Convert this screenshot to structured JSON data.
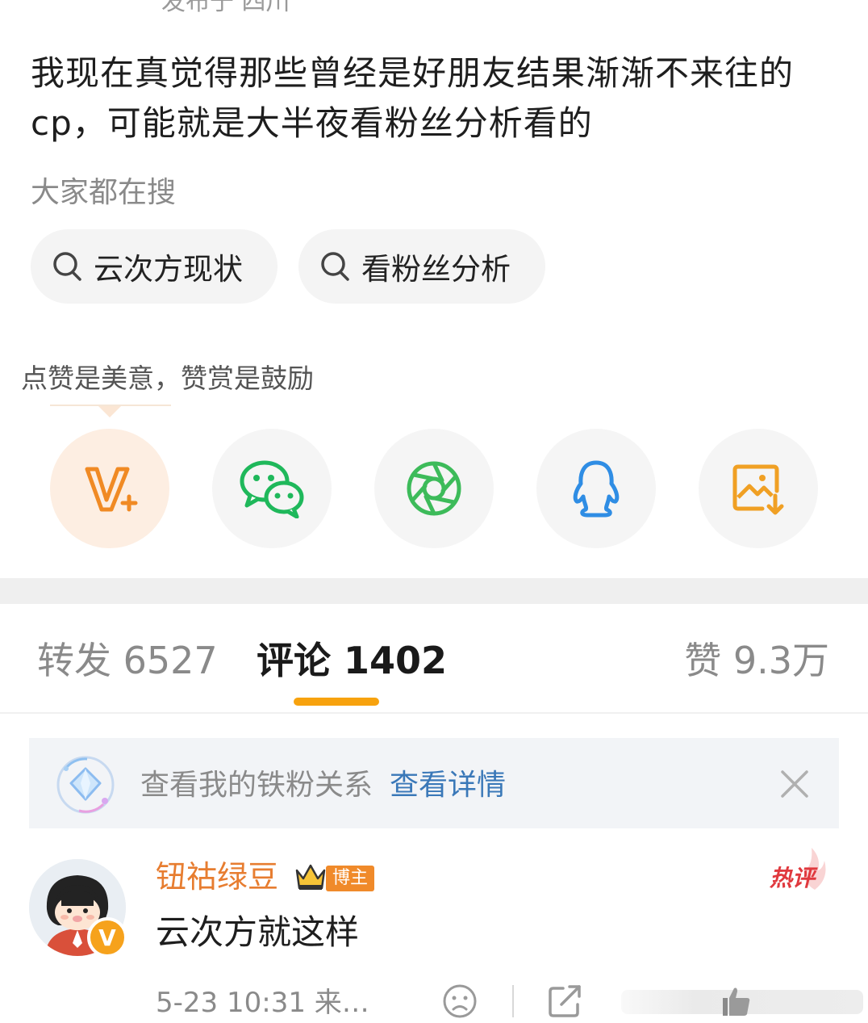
{
  "post": {
    "location": "发布于 四川",
    "text": "我现在真觉得那些曾经是好朋友结果渐渐不来往的cp，可能就是大半夜看粉丝分析看的"
  },
  "search": {
    "heading": "大家都在搜",
    "chips": [
      "云次方现状",
      "看粉丝分析"
    ]
  },
  "reward": {
    "tip": "点赞是美意，赞赏是鼓励"
  },
  "share_icons": [
    "v-plus-icon",
    "wechat-icon",
    "moments-icon",
    "qq-icon",
    "save-image-icon"
  ],
  "tabs": {
    "repost": "转发 6527",
    "comments": "评论 1402",
    "likes": "赞 9.3万"
  },
  "fan_banner": {
    "text": "查看我的铁粉关系",
    "link": "查看详情"
  },
  "comment": {
    "username": "钮祜绿豆",
    "badge": "博主",
    "vip": "V",
    "text": "云次方就这样",
    "meta": "5-23 10:31 来…",
    "hot_label": "热评"
  },
  "colors": {
    "accent_orange": "#f7a20e",
    "link_blue": "#3a78b8",
    "username_orange": "#e77d30",
    "hot_red": "#e0393e"
  }
}
